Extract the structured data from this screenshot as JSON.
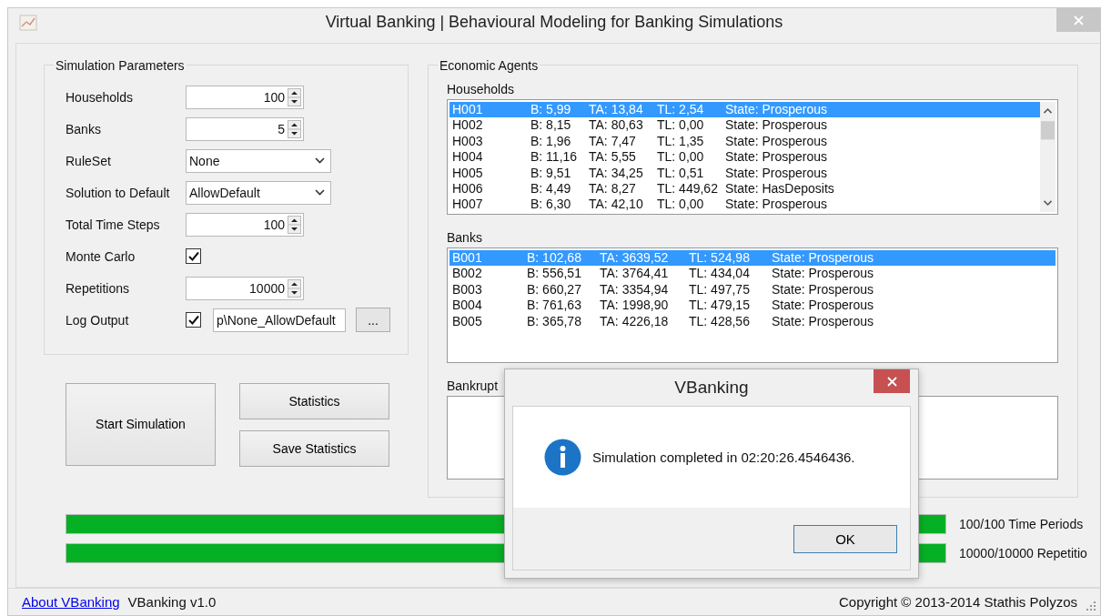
{
  "window": {
    "title": "Virtual Banking | Behavioural Modeling for Banking Simulations"
  },
  "simulation_parameters": {
    "title": "Simulation Parameters",
    "fields": [
      {
        "kind": "numeric",
        "label": "Households",
        "value": "100"
      },
      {
        "kind": "numeric",
        "label": "Banks",
        "value": "5"
      },
      {
        "kind": "combo",
        "label": "RuleSet",
        "value": "None"
      },
      {
        "kind": "combo",
        "label": "Solution to Default",
        "value": "AllowDefault"
      },
      {
        "kind": "numeric",
        "label": "Total Time Steps",
        "value": "100"
      },
      {
        "kind": "checkbox",
        "label": "Monte Carlo",
        "checked": true
      },
      {
        "kind": "numeric",
        "label": "Repetitions",
        "value": "10000"
      },
      {
        "kind": "log",
        "label": "Log Output",
        "checked": true,
        "value": "p\\None_AllowDefault",
        "browse": "..."
      }
    ]
  },
  "buttons": {
    "start": "Start Simulation",
    "statistics": "Statistics",
    "save_statistics": "Save Statistics"
  },
  "economic_agents": {
    "title": "Economic Agents",
    "households": {
      "label": "Households",
      "rows": [
        {
          "cells": [
            "H001",
            "B: 5,99",
            "TA: 13,84",
            "TL: 2,54",
            "State: Prosperous"
          ],
          "selected": true
        },
        {
          "cells": [
            "H002",
            "B: 8,15",
            "TA: 80,63",
            "TL: 0,00",
            "State: Prosperous"
          ],
          "selected": false
        },
        {
          "cells": [
            "H003",
            "B: 1,96",
            "TA: 7,47",
            "TL: 1,35",
            "State: Prosperous"
          ],
          "selected": false
        },
        {
          "cells": [
            "H004",
            "B: 11,16",
            "TA: 5,55",
            "TL: 0,00",
            "State: Prosperous"
          ],
          "selected": false
        },
        {
          "cells": [
            "H005",
            "B: 9,51",
            "TA: 34,25",
            "TL: 0,51",
            "State: Prosperous"
          ],
          "selected": false
        },
        {
          "cells": [
            "H006",
            "B: 4,49",
            "TA: 8,27",
            "TL: 449,62",
            "State: HasDeposits"
          ],
          "selected": false
        },
        {
          "cells": [
            "H007",
            "B: 6,30",
            "TA: 42,10",
            "TL: 0,00",
            "State: Prosperous"
          ],
          "selected": false
        }
      ]
    },
    "banks": {
      "label": "Banks",
      "rows": [
        {
          "cells": [
            "B001",
            "B: 102,68",
            "TA: 3639,52",
            "TL: 524,98",
            "State: Prosperous"
          ],
          "selected": true
        },
        {
          "cells": [
            "B002",
            "B: 556,51",
            "TA: 3764,41",
            "TL: 434,04",
            "State: Prosperous"
          ],
          "selected": false
        },
        {
          "cells": [
            "B003",
            "B: 660,27",
            "TA: 3354,94",
            "TL: 497,75",
            "State: Prosperous"
          ],
          "selected": false
        },
        {
          "cells": [
            "B004",
            "B: 761,63",
            "TA: 1998,90",
            "TL: 479,15",
            "State: Prosperous"
          ],
          "selected": false
        },
        {
          "cells": [
            "B005",
            "B: 365,78",
            "TA: 4226,18",
            "TL: 428,56",
            "State: Prosperous"
          ],
          "selected": false
        }
      ]
    },
    "bankrupt": {
      "label": "Bankrupt"
    }
  },
  "progress": [
    {
      "level": 1,
      "label": "100/100 Time Periods"
    },
    {
      "level": 1,
      "label": "10000/10000 Repetitio"
    }
  ],
  "status_bar": {
    "link": "About VBanking",
    "version": "VBanking v1.0",
    "copyright": "Copyright © 2013-2014 Stathis Polyzos"
  },
  "dialog": {
    "title": "VBanking",
    "message": "Simulation completed in 02:20:26.4546436.",
    "button": "OK"
  }
}
